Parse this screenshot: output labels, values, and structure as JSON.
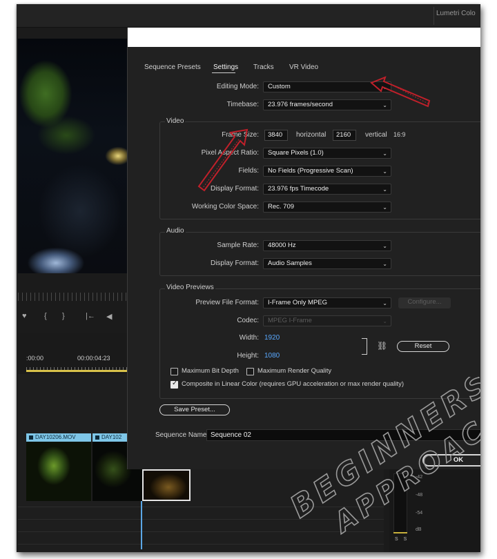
{
  "topbar": {
    "right_tab": "Lumetri Colo"
  },
  "player": {
    "controls": [
      "♥",
      "{",
      "}",
      "|←",
      "◀"
    ],
    "timecodes": [
      ":00:00",
      "00:00:04:23"
    ]
  },
  "timeline": {
    "clips": [
      {
        "label": "DAY10206.MOV"
      },
      {
        "label": "DAY102"
      }
    ]
  },
  "meter": {
    "db_labels": [
      "-42",
      "-48",
      "-54",
      "dB"
    ],
    "solo_labels": "S S"
  },
  "dialog": {
    "tabs": [
      "Sequence Presets",
      "Settings",
      "Tracks",
      "VR Video"
    ],
    "active_tab": "Settings",
    "editing_mode": {
      "label": "Editing Mode:",
      "value": "Custom"
    },
    "timebase": {
      "label": "Timebase:",
      "value": "23.976  frames/second"
    },
    "video": {
      "title": "Video",
      "frame_size": {
        "label": "Frame Size:",
        "width": "3840",
        "horizontal": "horizontal",
        "height": "2160",
        "vertical": "vertical",
        "aspect": "16:9"
      },
      "pixel_aspect": {
        "label": "Pixel Aspect Ratio:",
        "value": "Square Pixels (1.0)"
      },
      "fields": {
        "label": "Fields:",
        "value": "No Fields (Progressive Scan)"
      },
      "display_format": {
        "label": "Display Format:",
        "value": "23.976 fps Timecode"
      },
      "working_color_space": {
        "label": "Working Color Space:",
        "value": "Rec. 709"
      }
    },
    "audio": {
      "title": "Audio",
      "sample_rate": {
        "label": "Sample Rate:",
        "value": "48000 Hz"
      },
      "display_format": {
        "label": "Display Format:",
        "value": "Audio Samples"
      }
    },
    "previews": {
      "title": "Video Previews",
      "file_format": {
        "label": "Preview File Format:",
        "value": "I-Frame Only MPEG"
      },
      "configure_label": "Configure...",
      "codec": {
        "label": "Codec:",
        "value": "MPEG I-Frame"
      },
      "width": {
        "label": "Width:",
        "value": "1920"
      },
      "height": {
        "label": "Height:",
        "value": "1080"
      },
      "reset_label": "Reset",
      "max_bit_depth": {
        "label": "Maximum Bit Depth",
        "checked": false
      },
      "max_render_quality": {
        "label": "Maximum Render Quality",
        "checked": false
      },
      "linear_color": {
        "label": "Composite in Linear Color (requires GPU acceleration or max render quality)",
        "checked": true
      }
    },
    "save_preset_label": "Save Preset...",
    "sequence_name": {
      "label": "Sequence Name:",
      "value": "Sequence 02"
    },
    "ok_label": "OK"
  },
  "watermark": {
    "line1": "BEGINNERS",
    "line2": "APPROACH"
  },
  "colors": {
    "annotation_arrow": "#c0202a",
    "accent_blue": "#5aa9ff",
    "clip_label": "#7ec6e8"
  }
}
